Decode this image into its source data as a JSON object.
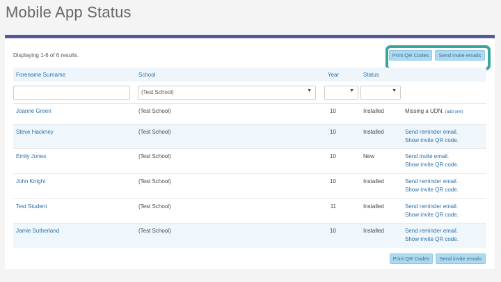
{
  "page": {
    "title": "Mobile App Status"
  },
  "panel": {
    "summary": "Displaying 1-6 of 6 results.",
    "print_qr_label": "Print QR Codes",
    "send_invite_label": "Send invite emails"
  },
  "table": {
    "headers": {
      "name": "Forename Surname",
      "school": "School",
      "year": "Year",
      "status": "Status"
    },
    "filters": {
      "school_value": "(Test School)",
      "year_value": "",
      "status_value": ""
    },
    "rows": [
      {
        "name": "Joanne Green",
        "school": "(Test School)",
        "year": "10",
        "status": "Installed",
        "action1": "Missing a UDN.",
        "action1_extra": "(add one)",
        "action2": ""
      },
      {
        "name": "Steve Hackney",
        "school": "(Test School)",
        "year": "10",
        "status": "Installed",
        "action1": "Send reminder email.",
        "action1_extra": "",
        "action2": "Show invite QR code."
      },
      {
        "name": "Emily Jones",
        "school": "(Test School)",
        "year": "10",
        "status": "New",
        "action1": "Send invite email.",
        "action1_extra": "",
        "action2": "Show invite QR code."
      },
      {
        "name": "John Knight",
        "school": "(Test School)",
        "year": "10",
        "status": "Installed",
        "action1": "Send reminder email.",
        "action1_extra": "",
        "action2": "Show invite QR code."
      },
      {
        "name": "Test Student",
        "school": "(Test School)",
        "year": "11",
        "status": "Installed",
        "action1": "Send reminder email.",
        "action1_extra": "",
        "action2": "Show invite QR code."
      },
      {
        "name": "Jamie Sutherland",
        "school": "(Test School)",
        "year": "10",
        "status": "Installed",
        "action1": "Send reminder email.",
        "action1_extra": "",
        "action2": "Show invite QR code."
      }
    ]
  },
  "colors": {
    "accent_bar": "#55589a",
    "highlight": "#3aa59d",
    "button_bg": "#aedaf0",
    "link": "#2a6fa8"
  },
  "icons": {
    "dropdown": "chevron-down-icon"
  }
}
